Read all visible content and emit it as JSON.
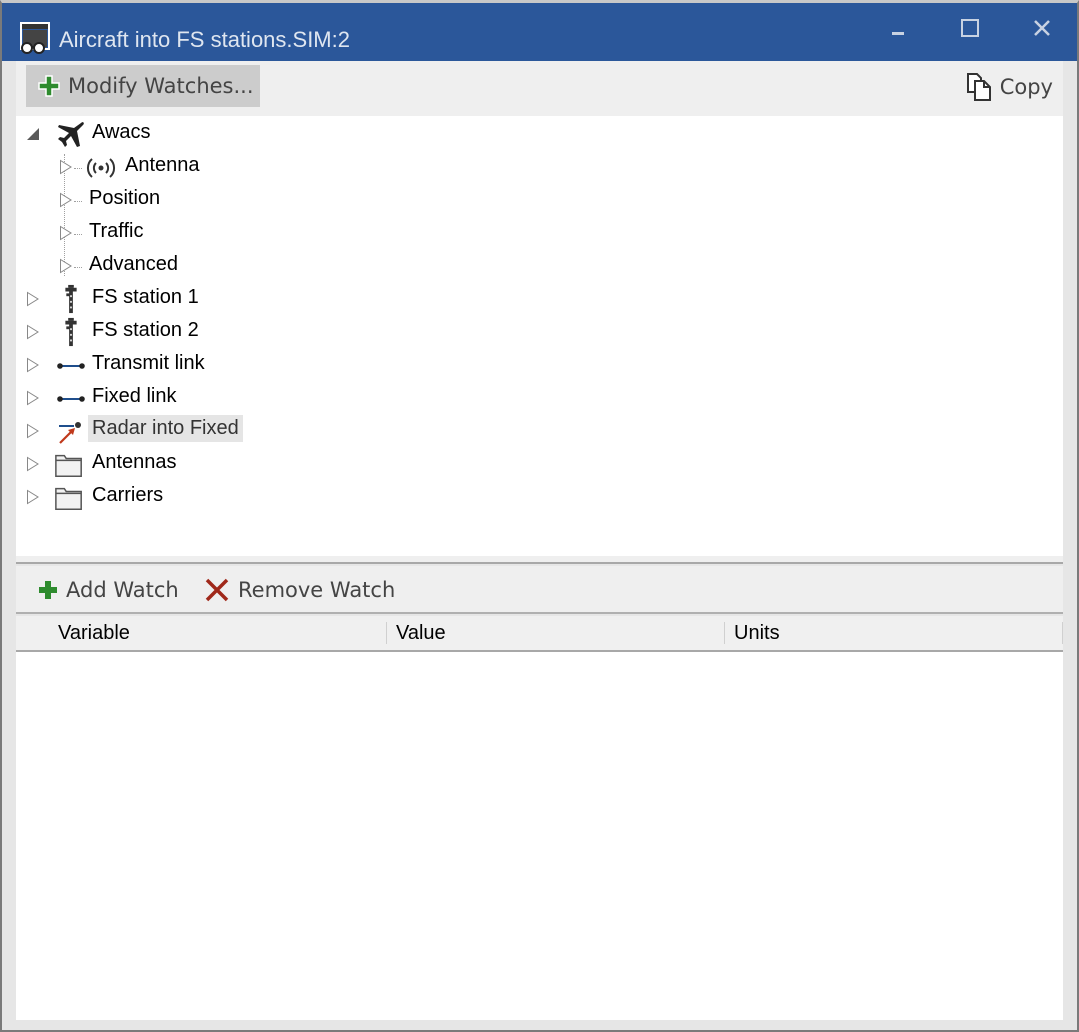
{
  "window": {
    "title": "Aircraft into FS stations.SIM:2",
    "controls": {
      "minimize": "minimize",
      "maximize": "maximize",
      "close": "close"
    }
  },
  "toolbar": {
    "modify_label": "Modify Watches...",
    "copy_label": "Copy"
  },
  "tree": {
    "items": [
      {
        "label": "Awacs",
        "icon": "airplane-icon",
        "level": 0,
        "expanded": true
      },
      {
        "label": "Antenna",
        "icon": "antenna-icon",
        "level": 1,
        "expanded": false
      },
      {
        "label": "Position",
        "icon": "",
        "level": 1,
        "expanded": false
      },
      {
        "label": "Traffic",
        "icon": "",
        "level": 1,
        "expanded": false
      },
      {
        "label": "Advanced",
        "icon": "",
        "level": 1,
        "expanded": false
      },
      {
        "label": "FS station 1",
        "icon": "tower-icon",
        "level": 0,
        "expanded": false
      },
      {
        "label": "FS station 2",
        "icon": "tower-icon",
        "level": 0,
        "expanded": false
      },
      {
        "label": "Transmit link",
        "icon": "link-icon",
        "level": 0,
        "expanded": false
      },
      {
        "label": "Fixed link",
        "icon": "link-icon",
        "level": 0,
        "expanded": false
      },
      {
        "label": "Radar into Fixed",
        "icon": "interference-icon",
        "level": 0,
        "expanded": false,
        "selected": true
      },
      {
        "label": "Antennas",
        "icon": "folder-icon",
        "level": 0,
        "expanded": false
      },
      {
        "label": "Carriers",
        "icon": "folder-icon",
        "level": 0,
        "expanded": false
      }
    ]
  },
  "watch_toolbar": {
    "add_label": "Add Watch",
    "remove_label": "Remove Watch"
  },
  "watch_grid": {
    "columns": [
      "Variable",
      "Value",
      "Units"
    ],
    "rows": []
  },
  "colors": {
    "titlebar": "#2b579a",
    "add_green": "#2e8b2e",
    "remove_red": "#a0281a",
    "link_blue": "#1f4e8c"
  }
}
